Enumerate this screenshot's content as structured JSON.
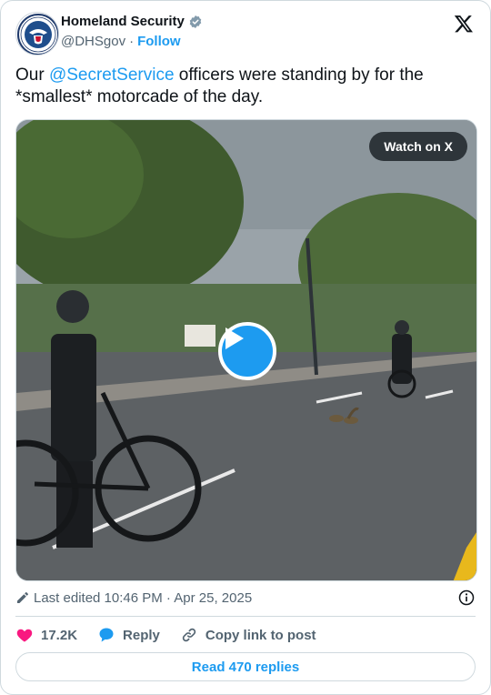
{
  "author": {
    "name": "Homeland Security",
    "handle": "@DHSgov",
    "separator": "·",
    "follow_label": "Follow"
  },
  "tweet": {
    "text_before": "Our ",
    "mention": "@SecretService",
    "text_after": " officers were standing by for the *smallest* motorcade of the day."
  },
  "media": {
    "watch_label": "Watch on X"
  },
  "meta": {
    "edited_text": "Last edited 10:46 PM · Apr 25, 2025"
  },
  "actions": {
    "likes": "17.2K",
    "reply_label": "Reply",
    "copy_label": "Copy link to post"
  },
  "footer": {
    "read_replies_label": "Read 470 replies"
  },
  "colors": {
    "accent": "#1d9bf0",
    "like": "#f91880",
    "muted": "#536471",
    "border": "#cfd9de"
  }
}
